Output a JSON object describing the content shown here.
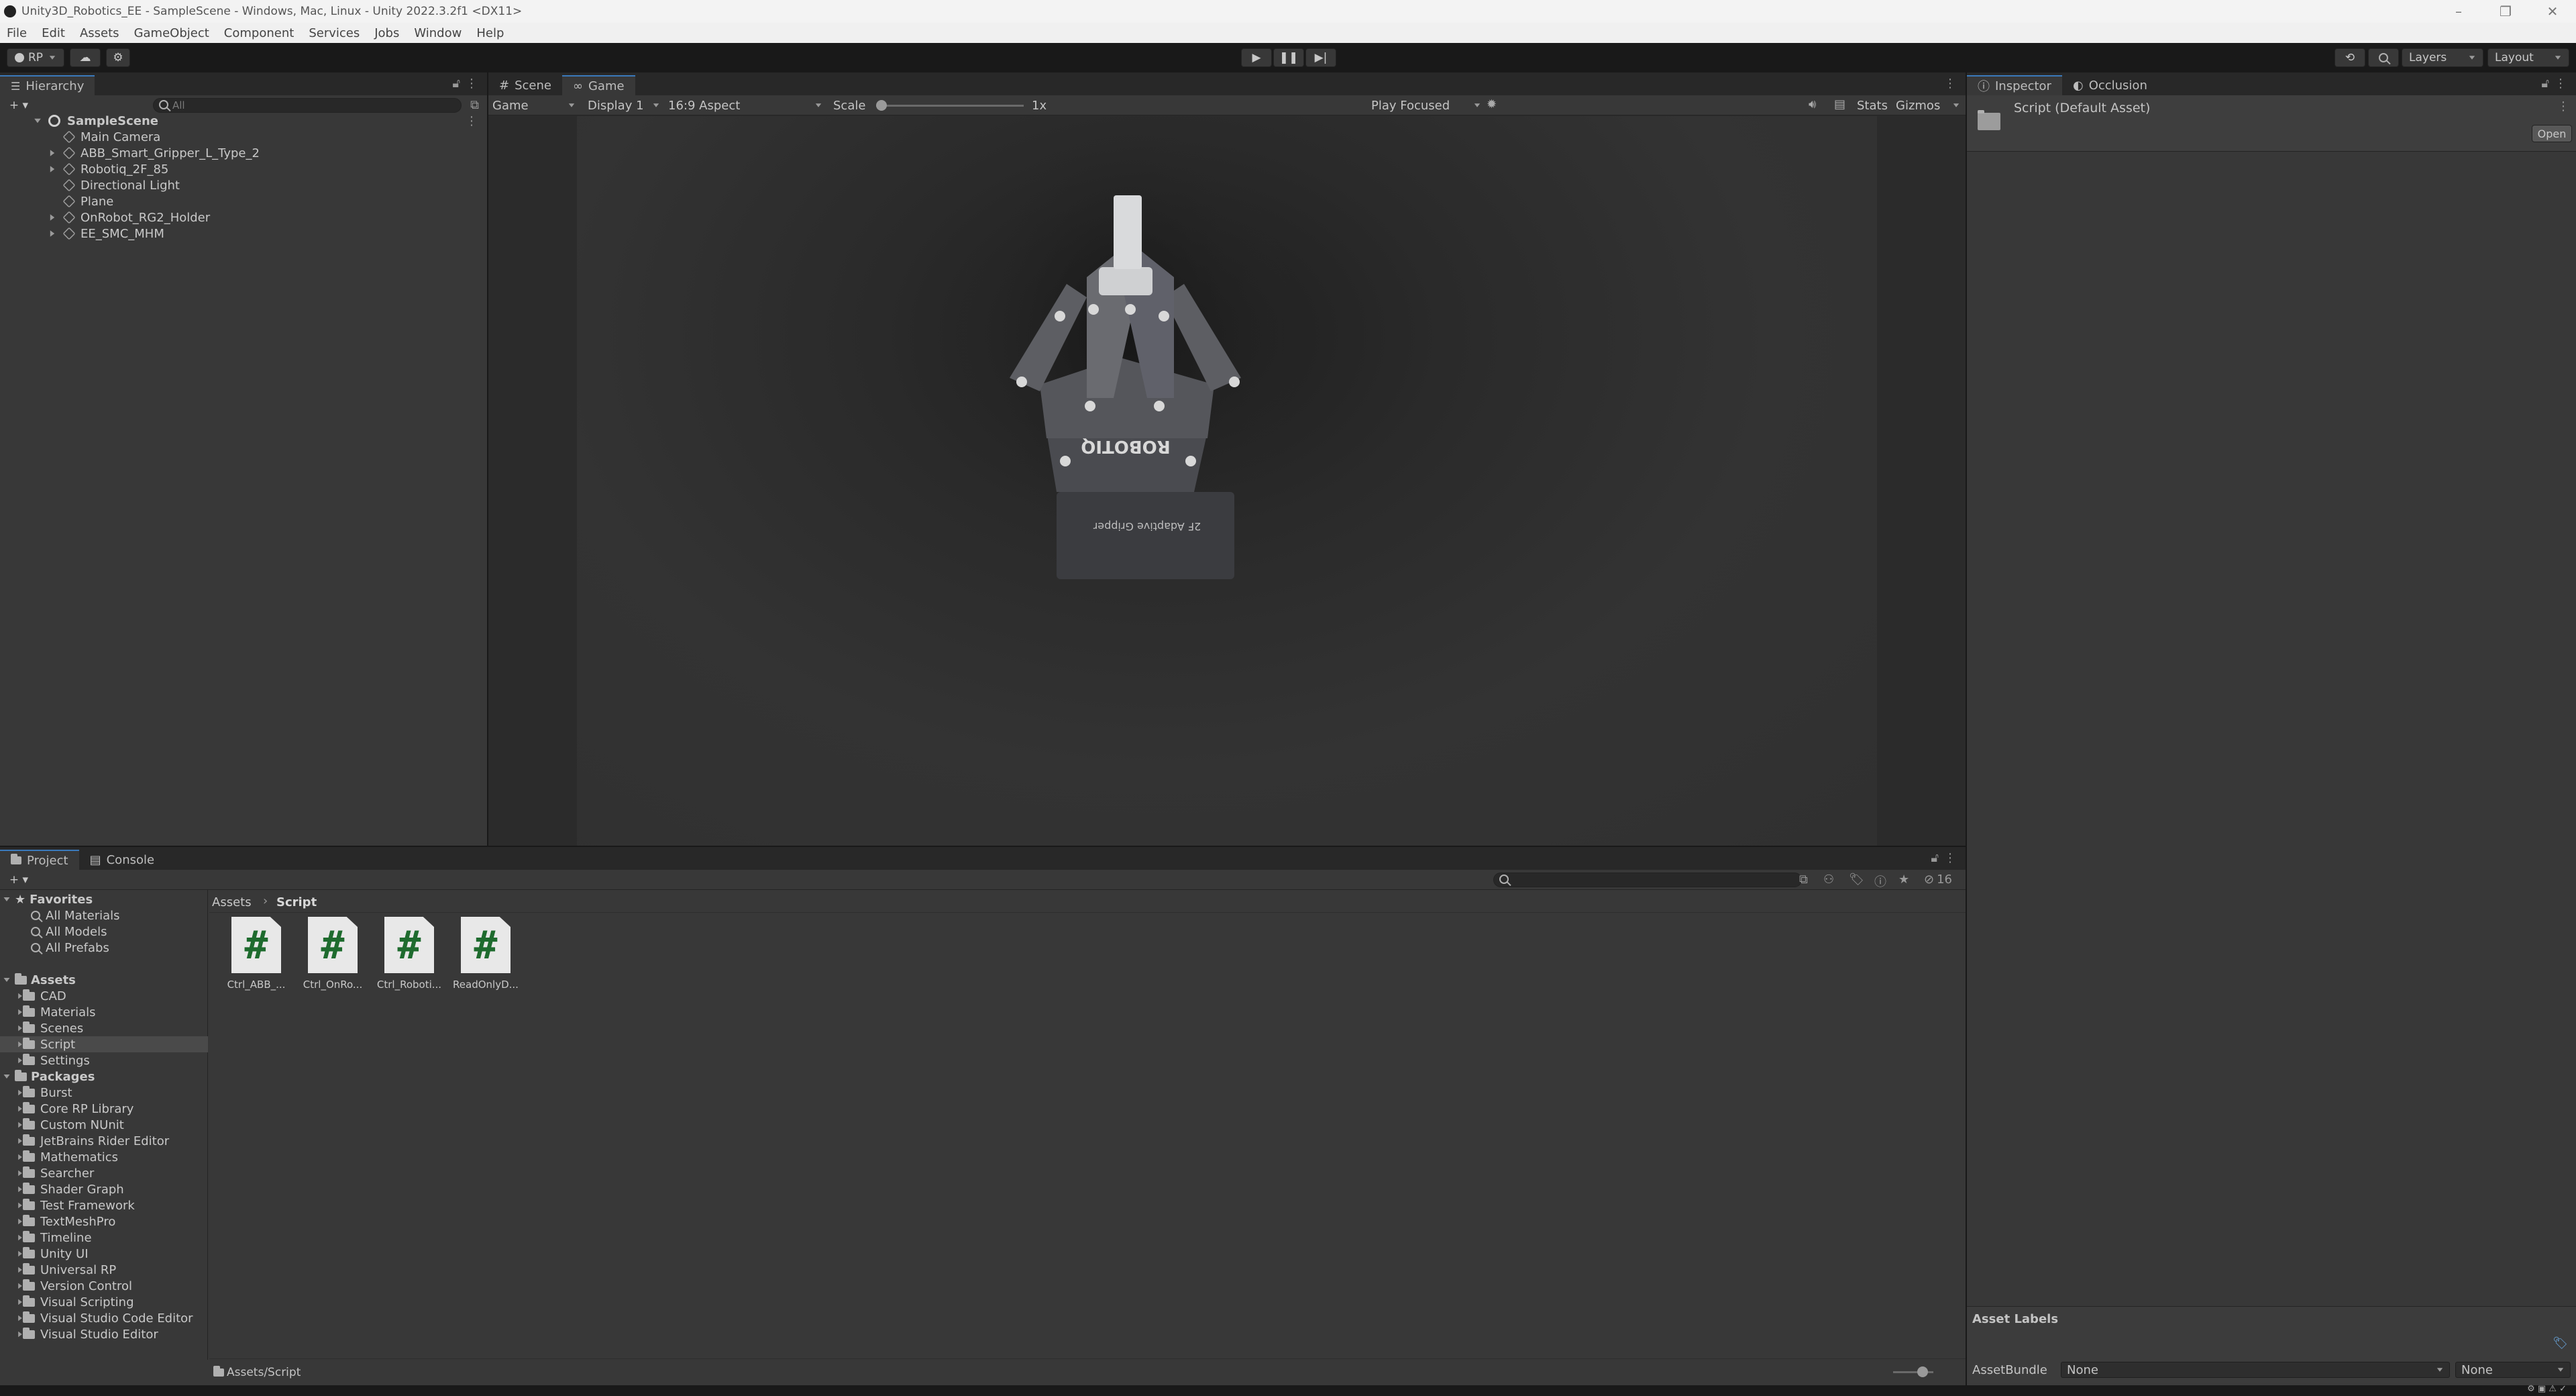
{
  "window": {
    "title": "Unity3D_Robotics_EE - SampleScene - Windows, Mac, Linux - Unity 2022.3.2f1 <DX11>"
  },
  "menu": [
    "File",
    "Edit",
    "Assets",
    "GameObject",
    "Component",
    "Services",
    "Jobs",
    "Window",
    "Help"
  ],
  "toolbar": {
    "account_label": "RP",
    "layers_label": "Layers",
    "layout_label": "Layout"
  },
  "hierarchy": {
    "tab": "Hierarchy",
    "search_placeholder": "All",
    "scene": "SampleScene",
    "items": [
      {
        "label": "Main Camera",
        "expandable": false
      },
      {
        "label": "ABB_Smart_Gripper_L_Type_2",
        "expandable": true
      },
      {
        "label": "Robotiq_2F_85",
        "expandable": true
      },
      {
        "label": "Directional Light",
        "expandable": false
      },
      {
        "label": "Plane",
        "expandable": false
      },
      {
        "label": "OnRobot_RG2_Holder",
        "expandable": true
      },
      {
        "label": "EE_SMC_MHM",
        "expandable": true
      }
    ]
  },
  "view_tabs": [
    "Scene",
    "Game"
  ],
  "game_toolbar": {
    "view_mode": "Game",
    "display": "Display 1",
    "aspect": "16:9 Aspect",
    "scale_label": "Scale",
    "scale_value": "1x",
    "scale_fraction": 0.0,
    "play_mode": "Play Focused",
    "stats": "Stats",
    "gizmos": "Gizmos"
  },
  "gripper_print": {
    "brand": "ROBOTIQ",
    "model": "2F Adaptive Gripper"
  },
  "inspector": {
    "tabs": [
      "Inspector",
      "Occlusion"
    ],
    "title": "Script (Default Asset)",
    "open_button": "Open",
    "asset_labels": "Asset Labels",
    "asset_bundle_label": "AssetBundle",
    "bundle_value": "None",
    "variant_value": "None"
  },
  "project": {
    "tabs": [
      "Project",
      "Console"
    ],
    "favorites_label": "Favorites",
    "favorites": [
      "All Materials",
      "All Models",
      "All Prefabs"
    ],
    "assets_label": "Assets",
    "assets": [
      "CAD",
      "Materials",
      "Scenes",
      "Script",
      "Settings"
    ],
    "selected_folder": "Script",
    "packages_label": "Packages",
    "packages": [
      "Burst",
      "Core RP Library",
      "Custom NUnit",
      "JetBrains Rider Editor",
      "Mathematics",
      "Searcher",
      "Shader Graph",
      "Test Framework",
      "TextMeshPro",
      "Timeline",
      "Unity UI",
      "Universal RP",
      "Version Control",
      "Visual Scripting",
      "Visual Studio Code Editor",
      "Visual Studio Editor"
    ],
    "breadcrumb": [
      "Assets",
      "Script"
    ],
    "files": [
      "Ctrl_ABB_...",
      "Ctrl_OnRo...",
      "Ctrl_Roboti...",
      "ReadOnlyD..."
    ],
    "file_glyph": "#",
    "status_path": "Assets/Script",
    "hidden_count": "16"
  }
}
